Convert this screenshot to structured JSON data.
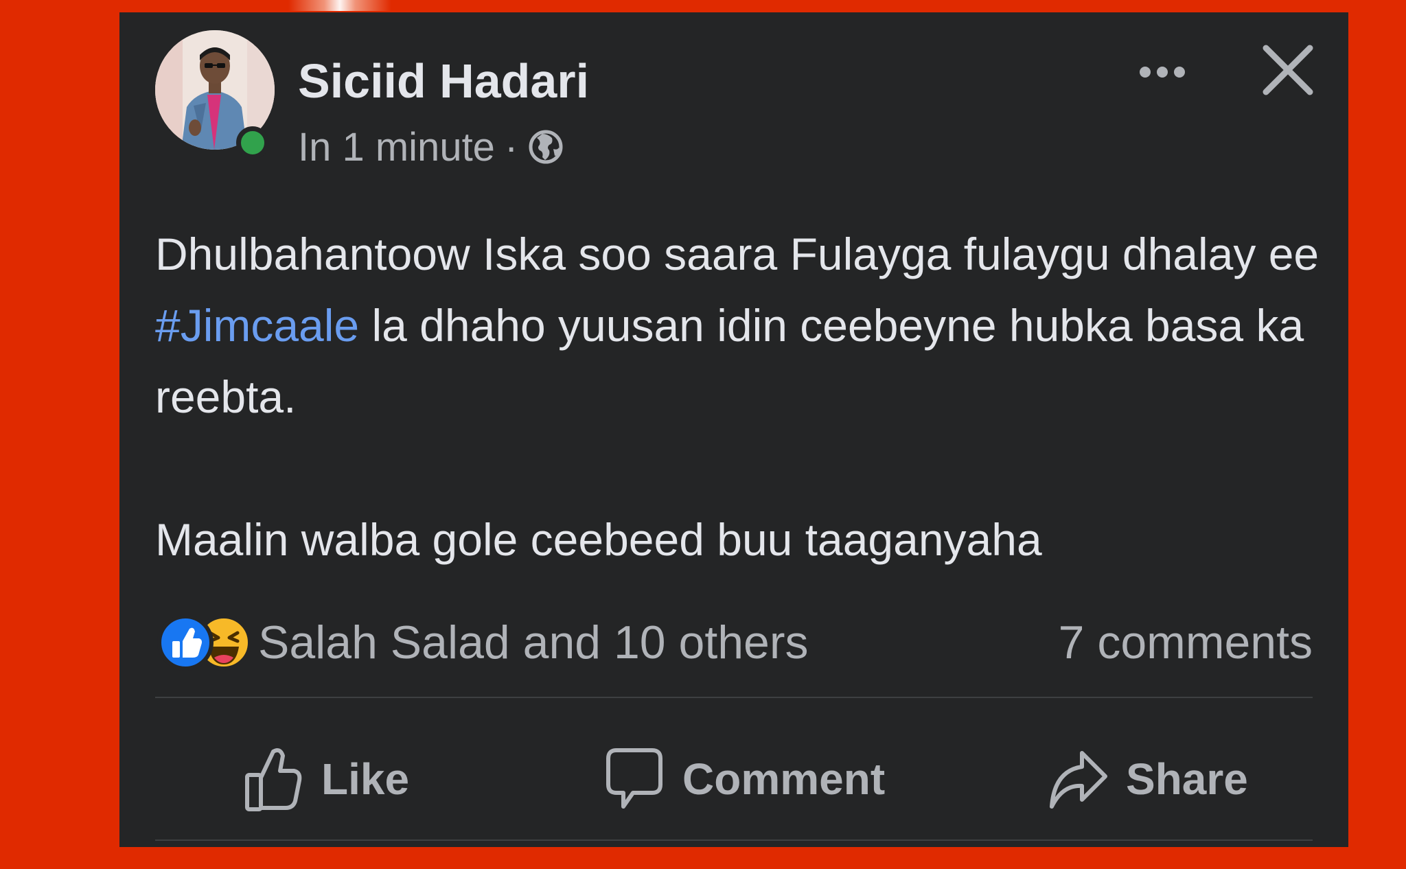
{
  "post": {
    "author_name": "Siciid Hadari",
    "timestamp": "In 1 minute",
    "separator": "·",
    "privacy_icon": "globe-icon",
    "text_before_hashtag": "Dhulbahantoow Iska soo saara Fulayga fulaygu dhalay ee ",
    "hashtag": "#Jimcaale",
    "text_after_hashtag": " la dhaho yuusan idin ceebeyne hubka basa ka reebta.",
    "second_paragraph": "Maalin walba gole ceebeed buu taaganyaha"
  },
  "reactions": {
    "icons": [
      "like-reaction-icon",
      "haha-reaction-icon"
    ],
    "summary": "Salah Salad and 10 others",
    "comments": "7 comments"
  },
  "actions": {
    "like_label": "Like",
    "comment_label": "Comment",
    "share_label": "Share"
  },
  "colors": {
    "background": "#e02a00",
    "card": "#242526",
    "primary_text": "#e4e6eb",
    "secondary_text": "#b0b3b8",
    "hashtag": "#6a9df0",
    "online": "#31a24c",
    "like_blue": "#1877f2",
    "haha_yellow": "#f7b928"
  }
}
